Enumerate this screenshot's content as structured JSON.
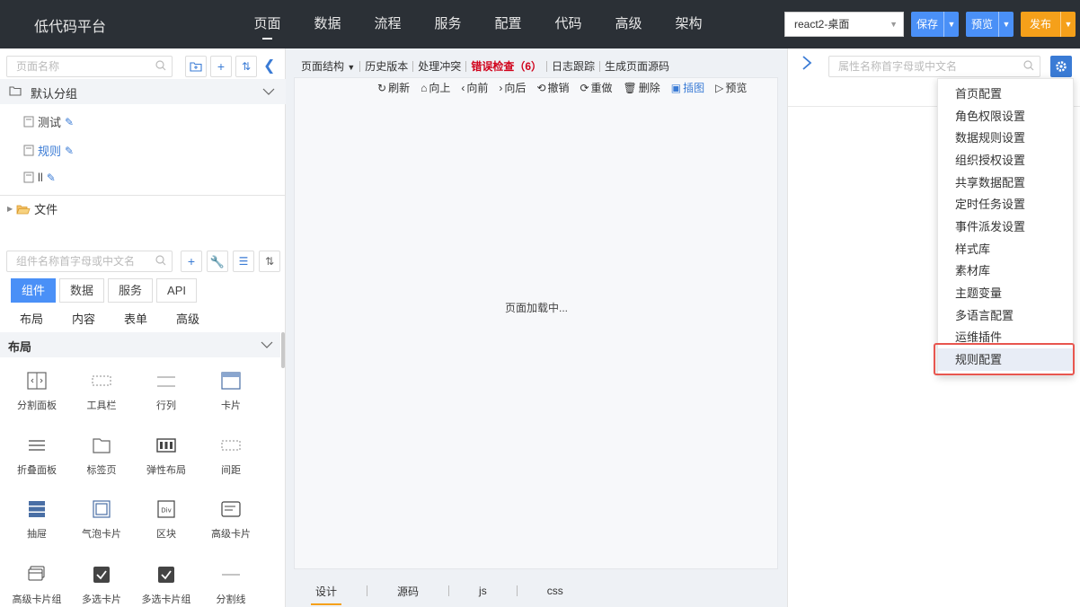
{
  "app": {
    "title": "低代码平台"
  },
  "nav": [
    "页面",
    "数据",
    "流程",
    "服务",
    "配置",
    "代码",
    "高级",
    "架构"
  ],
  "header": {
    "project": "react2-桌面",
    "save": "保存",
    "preview": "预览",
    "publish": "发布"
  },
  "pages": {
    "search_placeholder": "页面名称",
    "group": "默认分组",
    "items": [
      "测试",
      "规则",
      "ll"
    ],
    "folder": "文件"
  },
  "components": {
    "search_placeholder": "组件名称首字母或中文名",
    "tabs": [
      "组件",
      "数据",
      "服务",
      "API"
    ],
    "subtabs": [
      "布局",
      "内容",
      "表单",
      "高级"
    ],
    "category": "布局",
    "items": [
      "分割面板",
      "工具栏",
      "行列",
      "卡片",
      "折叠面板",
      "标签页",
      "弹性布局",
      "间距",
      "抽屉",
      "气泡卡片",
      "区块",
      "高级卡片",
      "高级卡片组",
      "多选卡片",
      "多选卡片组",
      "分割线"
    ]
  },
  "editor": {
    "toolbar": [
      "页面结构",
      "历史版本",
      "处理冲突",
      "错误检查（6）",
      "日志跟踪",
      "生成页面源码"
    ],
    "actions": [
      "刷新",
      "向上",
      "向前",
      "向后",
      "撤销",
      "重做",
      "删除",
      "插图",
      "预览"
    ],
    "loading": "页面加载中...",
    "bottom_tabs": [
      "设计",
      "源码",
      "js",
      "css"
    ]
  },
  "props": {
    "search_placeholder": "属性名称首字母或中文名"
  },
  "menu": {
    "items": [
      "首页配置",
      "角色权限设置",
      "数据规则设置",
      "组织授权设置",
      "共享数据配置",
      "定时任务设置",
      "事件派发设置",
      "样式库",
      "素材库",
      "主题变量",
      "多语言配置",
      "运维插件",
      "规则配置"
    ]
  }
}
